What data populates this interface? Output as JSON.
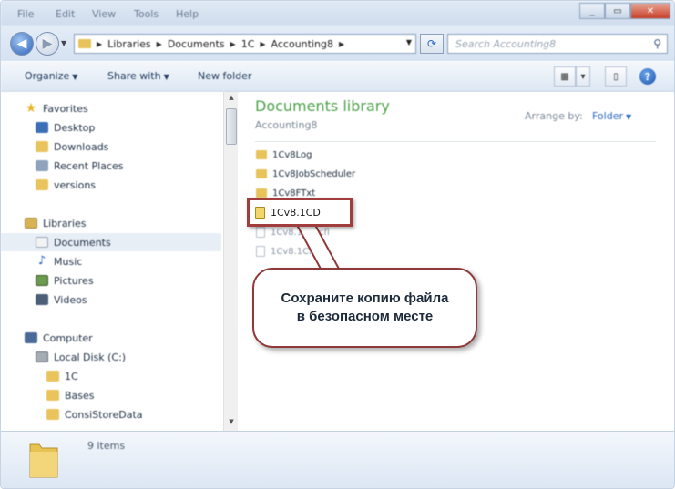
{
  "window": {
    "menu_items": [
      "File",
      "Edit",
      "View",
      "Tools",
      "Help"
    ]
  },
  "address_bar": {
    "breadcrumbs": [
      "Libraries",
      "Documents",
      "1C",
      "Accounting8"
    ],
    "search_placeholder": "Search Accounting8"
  },
  "toolbar": {
    "organize_label": "Organize",
    "share_label": "Share with",
    "new_folder_label": "New folder"
  },
  "nav_pane": {
    "favorites": {
      "label": "Favorites",
      "items": [
        "Desktop",
        "Downloads",
        "Recent Places",
        "versions"
      ]
    },
    "libraries": {
      "label": "Libraries",
      "items": [
        "Documents",
        "Music",
        "Pictures",
        "Videos"
      ]
    },
    "computer": {
      "label": "Computer",
      "disk": "Local Disk (C:)",
      "items": [
        "1C",
        "Bases",
        "ConsiStoreData"
      ]
    }
  },
  "content": {
    "title": "Documents library",
    "subtitle": "Accounting8",
    "arrange_label": "Arrange by:",
    "arrange_value": "Folder",
    "files": [
      {
        "name": "1Cv8Log",
        "type": "folder"
      },
      {
        "name": "1Cv8JobScheduler",
        "type": "folder"
      },
      {
        "name": "1Cv8FTxt",
        "type": "folder"
      },
      {
        "name": "1Cv8.1CD",
        "type": "db"
      },
      {
        "name": "1Cv8.1CD.cfl",
        "type": "doc"
      },
      {
        "name": "1Cv8.1CD.cfl",
        "type": "doc"
      }
    ],
    "highlighted_file": "1Cv8.1CD"
  },
  "callout": {
    "line1": "Сохраните копию файла",
    "line2": "в безопасном месте"
  },
  "details": {
    "item_count": "9 items"
  }
}
